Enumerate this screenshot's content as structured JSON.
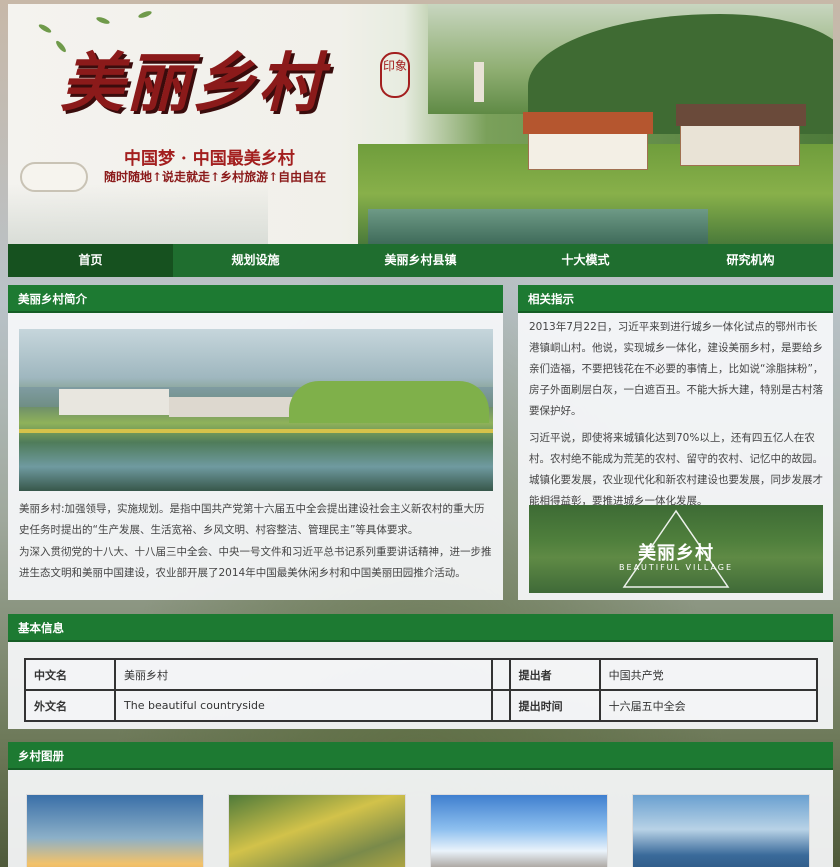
{
  "banner": {
    "title": "美丽乡村",
    "seal": "印象",
    "slogan": "中国梦 · 中国最美乡村",
    "tagline": "随时随地↑说走就走↑乡村旅游↑自由自在"
  },
  "nav": {
    "items": [
      {
        "label": "首页",
        "active": true
      },
      {
        "label": "规划设施",
        "active": false
      },
      {
        "label": "美丽乡村县镇",
        "active": false
      },
      {
        "label": "十大模式",
        "active": false
      },
      {
        "label": "研究机构",
        "active": false
      }
    ]
  },
  "intro": {
    "heading": "美丽乡村简介",
    "paragraphs": [
      "美丽乡村:加强领导，实施规划。是指中国共产党第十六届五中全会提出建设社会主义新农村的重大历史任务时提出的“生产发展、生活宽裕、乡风文明、村容整洁、管理民主”等具体要求。",
      "为深入贯彻党的十八大、十八届三中全会、中央一号文件和习近平总书记系列重要讲话精神，进一步推进生态文明和美丽中国建设，农业部开展了2014年中国最美休闲乡村和中国美丽田园推介活动。"
    ]
  },
  "guidance": {
    "heading": "相关指示",
    "paragraphs": [
      "2013年7月22日，习近平来到进行城乡一体化试点的鄂州市长港镇峒山村。他说，实现城乡一体化，建设美丽乡村，是要给乡亲们造福，不要把钱花在不必要的事情上，比如说“涂脂抹粉”，房子外面刷层白灰，一白遮百丑。不能大拆大建，特别是古村落要保护好。",
      "习近平说，即使将来城镇化达到70%以上，还有四五亿人在农村。农村绝不能成为荒芜的农村、留守的农村、记忆中的故园。城镇化要发展，农业现代化和新农村建设也要发展，同步发展才能相得益彰，要推进城乡一体化发展。"
    ],
    "image_title": "美丽乡村",
    "image_subtitle": "BEAUTIFUL VILLAGE"
  },
  "basic_info": {
    "heading": "基本信息",
    "rows": [
      {
        "k1": "中文名",
        "v1": "美丽乡村",
        "k2": "提出者",
        "v2": "中国共产党"
      },
      {
        "k1": "外文名",
        "v1": "The beautiful countryside",
        "k2": "提出时间",
        "v2": "十六届五中全会"
      }
    ]
  },
  "gallery": {
    "heading": "乡村图册"
  },
  "colors": {
    "nav_green": "#1f6e2f",
    "header_green": "#1d7a32",
    "title_red": "#8b1a1a"
  }
}
